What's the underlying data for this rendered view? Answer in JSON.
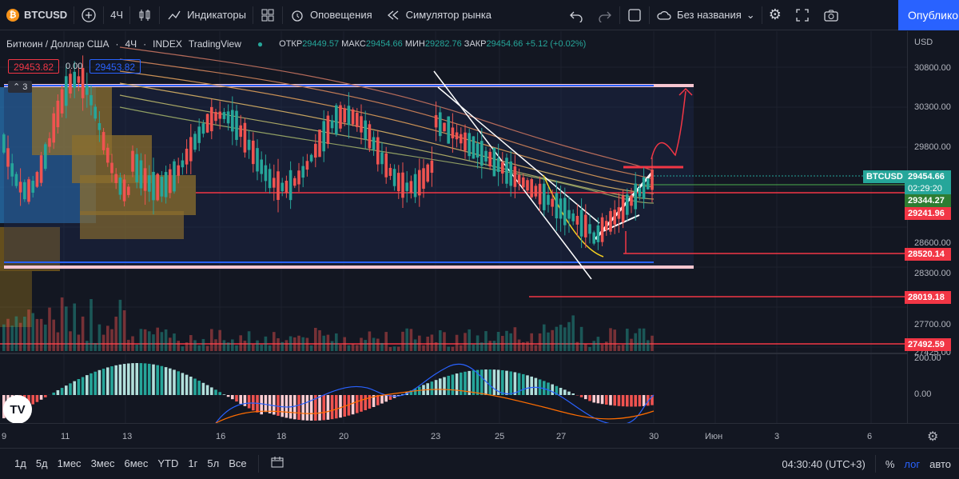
{
  "toolbar": {
    "symbol": "BTCUSD",
    "interval": "4Ч",
    "indicators": "Индикаторы",
    "alerts": "Оповещения",
    "replay": "Симулятор рынка",
    "layout_name": "Без названия",
    "publish": "Опубликовать"
  },
  "legend": {
    "title": "Биткоин / Доллар США",
    "interval": "4Ч",
    "exchange": "INDEX",
    "source": "TradingView",
    "open_label": "ОТКР",
    "open": "29449.57",
    "high_label": "МАКС",
    "high": "29454.66",
    "low_label": "МИН",
    "low": "29282.76",
    "close_label": "ЗАКР",
    "close": "29454.66",
    "change": "+5.12 (+0.02%)",
    "bid": "29453.82",
    "spread": "0.00",
    "ask": "29453.82",
    "collapsed_count": "3"
  },
  "price_scale": {
    "currency": "USD",
    "labels": [
      "30800.00",
      "30300.00",
      "29800.00",
      "28600.00",
      "28300.00",
      "27700.00",
      "27425.00"
    ],
    "osc_labels": [
      "200.00",
      "0.00"
    ],
    "tags": [
      {
        "text": "BTCUSD",
        "color": "#26a69a"
      },
      {
        "text": "29454.66",
        "color": "#26a69a"
      },
      {
        "text": "02:29:20",
        "color": "#26a69a"
      },
      {
        "text": "29344.27",
        "color": "#4caf50"
      },
      {
        "text": "29241.96",
        "color": "#f23645"
      },
      {
        "text": "28520.14",
        "color": "#f23645"
      },
      {
        "text": "28019.18",
        "color": "#f23645"
      },
      {
        "text": "27492.59",
        "color": "#f23645"
      }
    ]
  },
  "timescale": {
    "labels": [
      "9",
      "11",
      "13",
      "16",
      "18",
      "20",
      "23",
      "25",
      "27",
      "30",
      "Июн",
      "3",
      "6"
    ]
  },
  "bottombar": {
    "ranges": [
      "1д",
      "5д",
      "1мес",
      "3мес",
      "6мес",
      "YTD",
      "1г",
      "5л",
      "Все"
    ],
    "clock": "04:30:40 (UTC+3)",
    "percent": "%",
    "log": "лог",
    "auto": "авто"
  },
  "colors": {
    "up": "#26a69a",
    "down": "#ef5350",
    "accent": "#2962ff",
    "bg": "#131722"
  }
}
